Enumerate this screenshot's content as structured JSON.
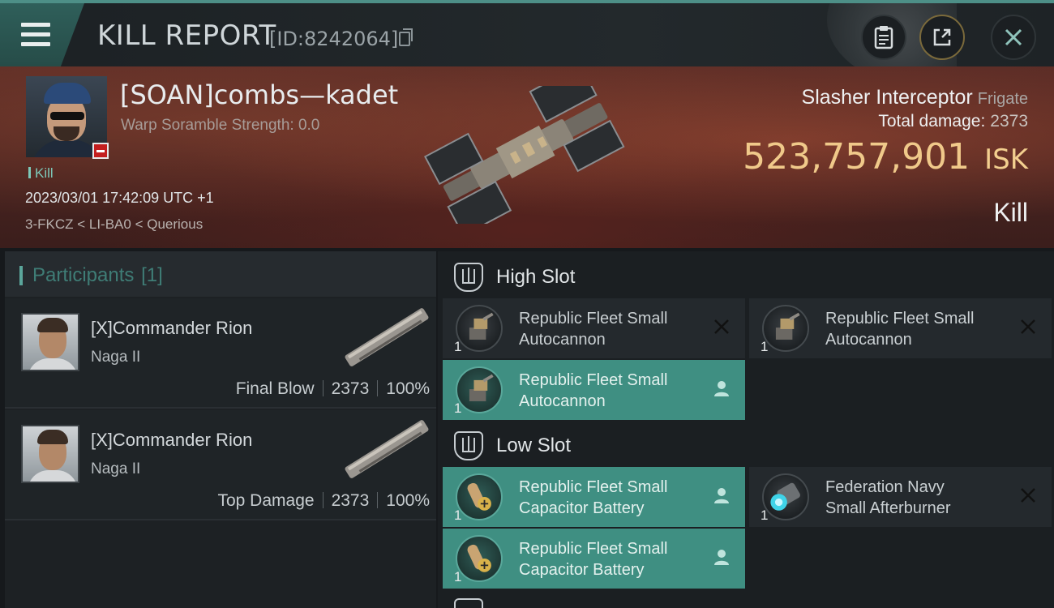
{
  "header": {
    "title": "KILL REPORT",
    "id_label": "[ID:8242064]"
  },
  "victim": {
    "name": "[SOAN]combs—kadet",
    "scramble": "Warp Soramble Strength: 0.0",
    "tag": "Kill",
    "datetime": "2023/03/01 17:42:09 UTC +1",
    "location": "3-FKCZ < LI-BA0 < Querious",
    "ship_name": "Slasher Interceptor",
    "ship_class": "Frigate",
    "total_damage_label": "Total damage:",
    "total_damage": "2373",
    "isk_value": "523,757,901",
    "isk_unit": "ISK",
    "outcome": "Kill"
  },
  "participants": {
    "label": "Participants",
    "count": "[1]",
    "rows": [
      {
        "name": "[X]Commander Rion",
        "ship": "Naga II",
        "role": "Final Blow",
        "damage": "2373",
        "percent": "100%"
      },
      {
        "name": "[X]Commander Rion",
        "ship": "Naga II",
        "role": "Top Damage",
        "damage": "2373",
        "percent": "100%"
      }
    ]
  },
  "slots": {
    "high": {
      "title": "High Slot",
      "items": [
        {
          "qty": "1",
          "name_line1": "Republic Fleet Small",
          "name_line2": "Autocannon",
          "status": "destroyed",
          "status_icon": "close-icon",
          "icon": "autocannon-icon"
        },
        {
          "qty": "1",
          "name_line1": "Republic Fleet Small",
          "name_line2": "Autocannon",
          "status": "destroyed",
          "status_icon": "close-icon",
          "icon": "autocannon-icon"
        },
        {
          "qty": "1",
          "name_line1": "Republic Fleet Small",
          "name_line2": "Autocannon",
          "status": "dropped",
          "status_icon": "person-icon",
          "icon": "autocannon-icon"
        }
      ]
    },
    "low": {
      "title": "Low Slot",
      "items": [
        {
          "qty": "1",
          "name_line1": "Republic Fleet Small",
          "name_line2": "Capacitor Battery",
          "status": "dropped",
          "status_icon": "person-icon",
          "icon": "capacitor-battery-icon"
        },
        {
          "qty": "1",
          "name_line1": "Federation Navy",
          "name_line2": "Small Afterburner",
          "status": "destroyed",
          "status_icon": "close-icon",
          "icon": "afterburner-icon"
        },
        {
          "qty": "1",
          "name_line1": "Republic Fleet Small",
          "name_line2": "Capacitor Battery",
          "status": "dropped",
          "status_icon": "person-icon",
          "icon": "capacitor-battery-icon"
        }
      ]
    }
  },
  "colors": {
    "accent_teal": "#3f8f82",
    "isk_gold": "#f0c98a",
    "negative_red": "#c31e1e"
  }
}
